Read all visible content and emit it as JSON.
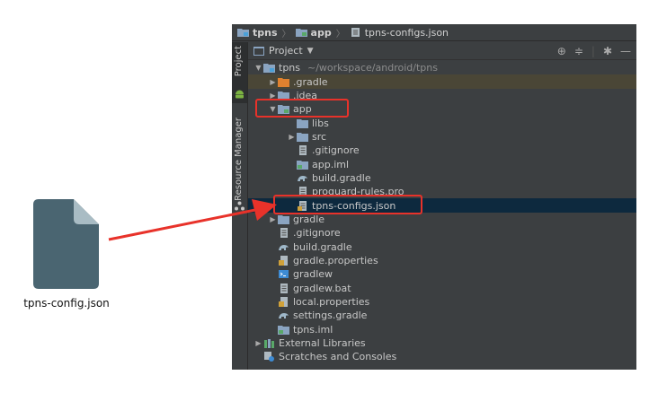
{
  "file_icon": {
    "caption": "tpns-config.json",
    "icon": "document-icon"
  },
  "breadcrumb": [
    {
      "label": "tpns",
      "bold": true,
      "icon": "project-folder-icon"
    },
    {
      "label": "app",
      "bold": true,
      "icon": "module-folder-icon"
    },
    {
      "label": "tpns-configs.json",
      "bold": false,
      "icon": "json-file-icon"
    }
  ],
  "side_tabs": {
    "project": "Project",
    "resource_manager": "Resource Manager"
  },
  "panel": {
    "title": "Project"
  },
  "tree": [
    {
      "label": "tpns",
      "extra": "~/workspace/android/tpns",
      "depth": 0,
      "arrow": "down",
      "icon": "project",
      "state": ""
    },
    {
      "label": ".gradle",
      "depth": 1,
      "arrow": "right",
      "icon": "folder-orange",
      "state": "excluded"
    },
    {
      "label": ".idea",
      "depth": 1,
      "arrow": "right",
      "icon": "folder",
      "state": ""
    },
    {
      "label": "app",
      "depth": 1,
      "arrow": "down",
      "icon": "module",
      "state": ""
    },
    {
      "label": "libs",
      "depth": 2,
      "arrow": "",
      "icon": "folder",
      "state": ""
    },
    {
      "label": "src",
      "depth": 2,
      "arrow": "right",
      "icon": "folder",
      "state": ""
    },
    {
      "label": ".gitignore",
      "depth": 2,
      "arrow": "",
      "icon": "text",
      "state": ""
    },
    {
      "label": "app.iml",
      "depth": 2,
      "arrow": "",
      "icon": "iml",
      "state": ""
    },
    {
      "label": "build.gradle",
      "depth": 2,
      "arrow": "",
      "icon": "gradle",
      "state": ""
    },
    {
      "label": "proguard-rules.pro",
      "depth": 2,
      "arrow": "",
      "icon": "text",
      "state": ""
    },
    {
      "label": "tpns-configs.json",
      "depth": 2,
      "arrow": "",
      "icon": "json",
      "state": "selected"
    },
    {
      "label": "gradle",
      "depth": 1,
      "arrow": "right",
      "icon": "folder",
      "state": ""
    },
    {
      "label": ".gitignore",
      "depth": 1,
      "arrow": "",
      "icon": "text",
      "state": ""
    },
    {
      "label": "build.gradle",
      "depth": 1,
      "arrow": "",
      "icon": "gradle",
      "state": ""
    },
    {
      "label": "gradle.properties",
      "depth": 1,
      "arrow": "",
      "icon": "properties",
      "state": ""
    },
    {
      "label": "gradlew",
      "depth": 1,
      "arrow": "",
      "icon": "shell",
      "state": ""
    },
    {
      "label": "gradlew.bat",
      "depth": 1,
      "arrow": "",
      "icon": "text",
      "state": ""
    },
    {
      "label": "local.properties",
      "depth": 1,
      "arrow": "",
      "icon": "properties",
      "state": ""
    },
    {
      "label": "settings.gradle",
      "depth": 1,
      "arrow": "",
      "icon": "gradle",
      "state": ""
    },
    {
      "label": "tpns.iml",
      "depth": 1,
      "arrow": "",
      "icon": "iml",
      "state": ""
    },
    {
      "label": "External Libraries",
      "depth": 0,
      "arrow": "right",
      "icon": "libraries",
      "state": ""
    },
    {
      "label": "Scratches and Consoles",
      "depth": 0,
      "arrow": "",
      "icon": "scratches",
      "state": ""
    }
  ],
  "colors": {
    "ide_bg": "#3c3f41",
    "highlight": "#e8322a",
    "selection": "#0d293e",
    "excluded": "#4a4636",
    "folder": "#8aa4c1",
    "folder_orange": "#e0812f"
  }
}
